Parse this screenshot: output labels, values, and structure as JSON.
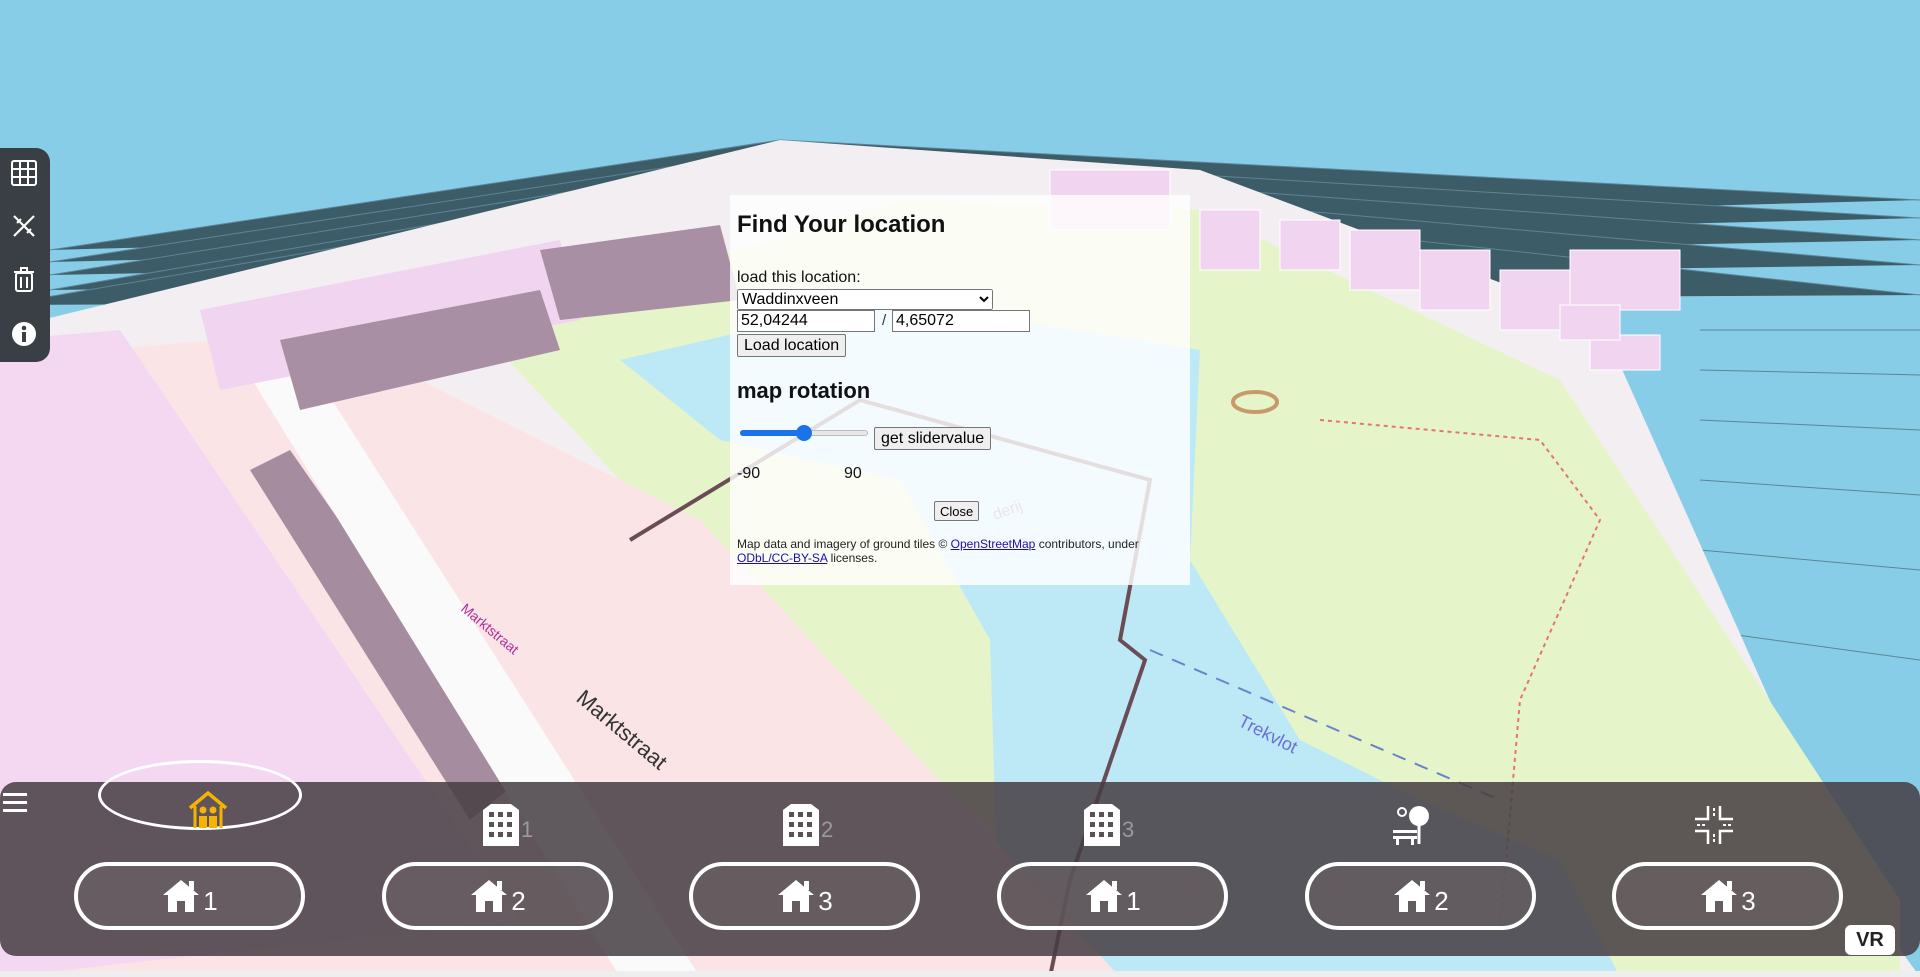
{
  "map": {
    "street_labels": [
      "Marktstraat",
      "Marktstraat",
      "Trekvlot",
      "derij"
    ],
    "colors": {
      "sky": "#87cde8",
      "park": "#e6f5c9",
      "water": "#bde9f7",
      "buildings": "#eed9ee"
    }
  },
  "left_toolbar": {
    "buttons": [
      {
        "icon": "grid-icon"
      },
      {
        "icon": "measure-icon"
      },
      {
        "icon": "trash-icon"
      },
      {
        "icon": "info-icon"
      }
    ]
  },
  "location_panel": {
    "title": "Find Your location",
    "load_label": "load this location:",
    "selected_location": "Waddinxveen",
    "latitude": "52,04244",
    "separator": "/",
    "longitude": "4,65072",
    "load_button": "Load location",
    "rotation_title": "map rotation",
    "slider_value": 0,
    "slider_min": "-90",
    "slider_max": "90",
    "slider_button": "get slidervalue",
    "close_button": "Close",
    "attribution": {
      "prefix": "Map data and imagery of ground tiles © ",
      "link1": "OpenStreetMap",
      "middle": " contributors, under ",
      "link2": "ODbL/CC-BY-SA",
      "suffix": " licenses."
    }
  },
  "bottom_bar": {
    "categories": [
      {
        "icon": "family-home-icon",
        "label": "",
        "selected": true
      },
      {
        "icon": "apartment-building-icon",
        "label": "1"
      },
      {
        "icon": "apartment-building-icon",
        "label": "2"
      },
      {
        "icon": "apartment-building-icon",
        "label": "3"
      },
      {
        "icon": "park-bench-tree-icon",
        "label": ""
      },
      {
        "icon": "crossroad-icon",
        "label": ""
      }
    ],
    "pills": [
      {
        "icon": "house-icon",
        "label": "1"
      },
      {
        "icon": "house-icon",
        "label": "2"
      },
      {
        "icon": "house-icon",
        "label": "3"
      },
      {
        "icon": "house-icon",
        "label": "1"
      },
      {
        "icon": "house-icon",
        "label": "2"
      },
      {
        "icon": "house-icon",
        "label": "3"
      }
    ],
    "vr_button": "VR"
  }
}
